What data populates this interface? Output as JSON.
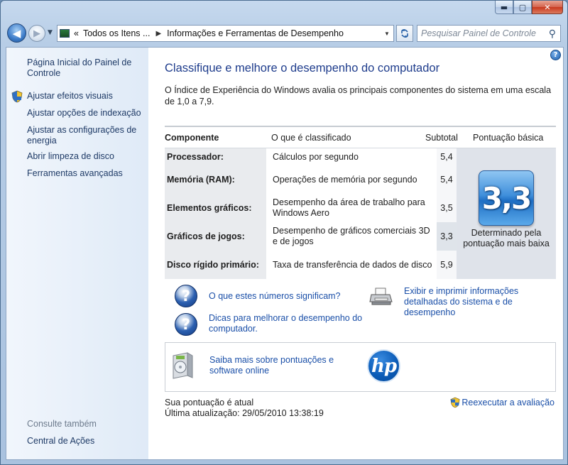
{
  "window": {
    "caption_buttons": {
      "minimize": "▬",
      "maximize": "▢",
      "close": "✕"
    }
  },
  "nav": {
    "back_glyph": "◀",
    "forward_glyph": "▶",
    "address": {
      "chevrons": "«",
      "segments": [
        "Todos os Itens ...",
        "Informações e Ferramentas de Desempenho"
      ],
      "separator": "▶"
    },
    "search_placeholder": "Pesquisar Painel de Controle",
    "search_icon": "magnifier-icon",
    "refresh_icon": "refresh-icon"
  },
  "sidebar": {
    "home": "Página Inicial do Painel de Controle",
    "items": [
      "Ajustar efeitos visuais",
      "Ajustar opções de indexação",
      "Ajustar as configurações de energia",
      "Abrir limpeza de disco",
      "Ferramentas avançadas"
    ],
    "see_also_heading": "Consulte também",
    "see_also": [
      "Central de Ações"
    ]
  },
  "main": {
    "help": "?",
    "title": "Classifique e melhore o desempenho do computador",
    "description": "O Índice de Experiência do Windows avalia os principais componentes do sistema em uma escala de 1,0 a 7,9.",
    "table": {
      "headers": [
        "Componente",
        "O que é classificado",
        "Subtotal",
        "Pontuação básica"
      ],
      "rows": [
        {
          "component": "Processador:",
          "what": "Cálculos por segundo",
          "subtotal": "5,4"
        },
        {
          "component": "Memória (RAM):",
          "what": "Operações de memória por segundo",
          "subtotal": "5,4"
        },
        {
          "component": "Elementos gráficos:",
          "what": "Desempenho da área de trabalho para Windows Aero",
          "subtotal": "3,5"
        },
        {
          "component": "Gráficos de jogos:",
          "what": "Desempenho de gráficos comerciais 3D e de jogos",
          "subtotal": "3,3"
        },
        {
          "component": "Disco rígido primário:",
          "what": "Taxa de transferência de dados de disco",
          "subtotal": "5,9"
        }
      ],
      "base_score": "3,3",
      "base_score_caption": "Determinado pela pontuação mais baixa"
    },
    "links": {
      "what_numbers_mean": "O que estes números significam?",
      "tips": "Dicas para melhorar o desempenho do computador.",
      "print_details": "Exibir e imprimir informações detalhadas do sistema e de desempenho"
    },
    "promo": {
      "text": "Saiba mais sobre pontuações e software online",
      "logo_text": "hp"
    },
    "status": {
      "current": "Sua pontuação é atual",
      "last_update": "Última atualização: 29/05/2010 13:38:19"
    },
    "rerun": "Reexecutar a avaliação"
  }
}
